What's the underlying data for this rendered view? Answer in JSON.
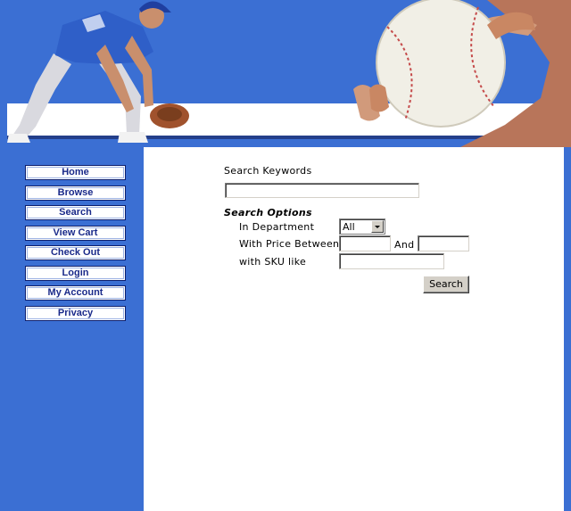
{
  "nav": {
    "items": [
      {
        "label": "Home"
      },
      {
        "label": "Browse"
      },
      {
        "label": "Search"
      },
      {
        "label": "View Cart"
      },
      {
        "label": "Check Out"
      },
      {
        "label": "Login"
      },
      {
        "label": "My Account"
      },
      {
        "label": "Privacy"
      }
    ]
  },
  "search": {
    "keywords_label": "Search Keywords",
    "keywords_value": "",
    "options_heading": "Search Options",
    "department_label": "In Department",
    "department_selected": "All",
    "price_label": "With Price Between",
    "price_and_label": "And",
    "price_min_value": "",
    "price_max_value": "",
    "sku_label": "with SKU like",
    "sku_value": "",
    "button_label": "Search"
  },
  "colors": {
    "background_blue": "#3b6fd3",
    "nav_text": "#1a2a8a",
    "content_bg": "#ffffff"
  }
}
